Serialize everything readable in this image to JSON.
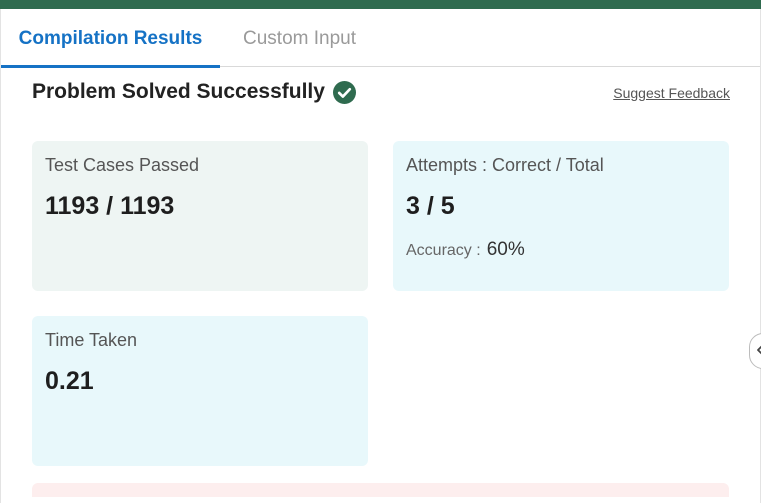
{
  "tabs": [
    {
      "label": "Compilation Results",
      "active": true
    },
    {
      "label": "Custom Input",
      "active": false
    }
  ],
  "status": {
    "title": "Problem Solved Successfully",
    "icon": "check-circle-icon",
    "color": "#2f6b4f"
  },
  "feedback_link": "Suggest Feedback",
  "test_cases": {
    "label": "Test Cases Passed",
    "value": "1193 / 1193"
  },
  "attempts": {
    "label": "Attempts : Correct / Total",
    "value": "3 / 5",
    "accuracy_label": "Accuracy :",
    "accuracy_value": "60%"
  },
  "time": {
    "label": "Time Taken",
    "value": "0.21"
  },
  "colors": {
    "accent": "#1572c5",
    "brand": "#2f6b4f",
    "card_green": "#eef5f3",
    "card_blue": "#e8f8fb"
  }
}
